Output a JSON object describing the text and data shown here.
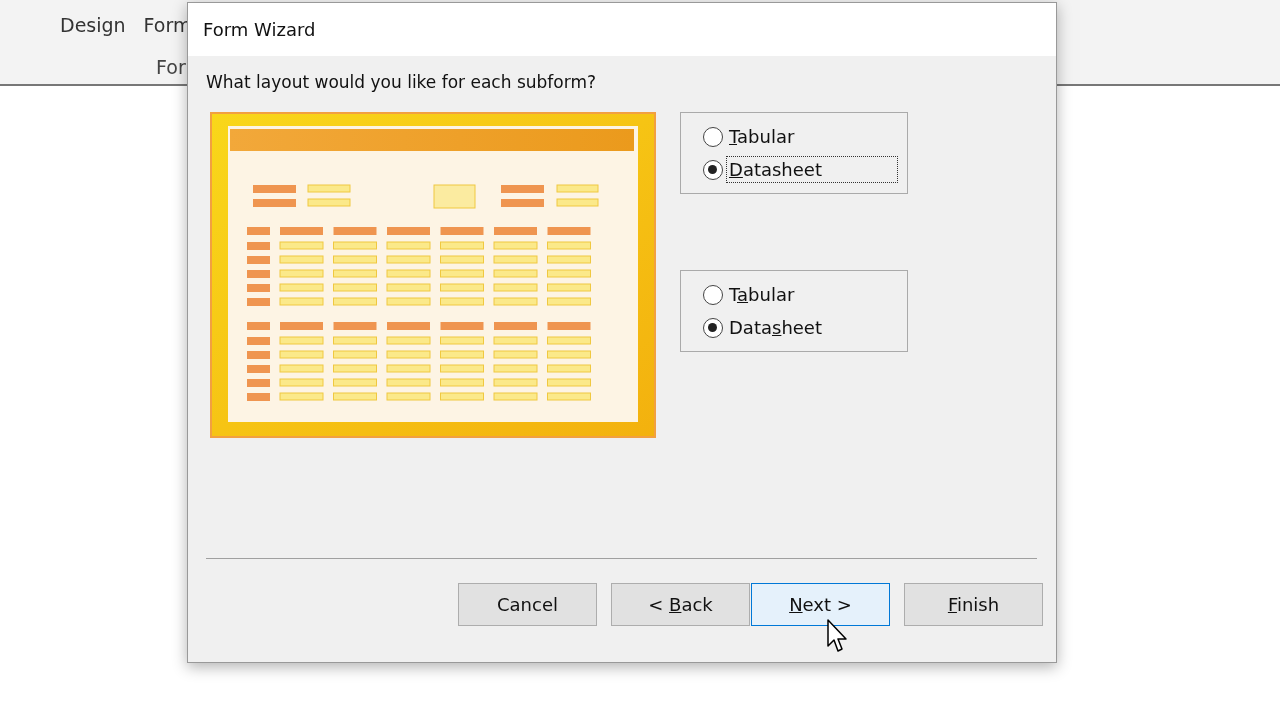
{
  "ribbon": {
    "labels": [
      "Design",
      "Form"
    ],
    "group_label": "For"
  },
  "dialog": {
    "title": "Form Wizard",
    "question": "What layout would you like for each subform?",
    "groups": [
      {
        "options": [
          {
            "access_key": "T",
            "after": "abular",
            "focused": false,
            "selected": false
          },
          {
            "access_key": "D",
            "after": "atasheet",
            "focused": true,
            "selected": true
          }
        ]
      },
      {
        "options": [
          {
            "before": "T",
            "access_key": "a",
            "after": "bular",
            "focused": false,
            "selected": false
          },
          {
            "before": "Data",
            "access_key": "s",
            "after": "heet",
            "focused": false,
            "selected": true
          }
        ]
      }
    ],
    "buttons": [
      {
        "before": "Cancel",
        "hovered": false
      },
      {
        "before": "< ",
        "access_key": "B",
        "after": "ack",
        "hovered": false
      },
      {
        "access_key": "N",
        "after": "ext >",
        "hovered": true
      },
      {
        "access_key": "F",
        "after": "inish",
        "hovered": false
      }
    ]
  }
}
